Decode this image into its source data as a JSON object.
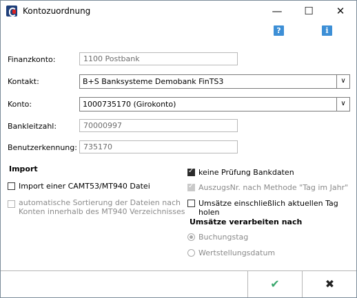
{
  "window": {
    "title": "Kontozuordnung"
  },
  "titlebar_controls": {
    "minimize": "—",
    "maximize": "☐",
    "close": "✕"
  },
  "help": {
    "question": "?",
    "info": "i"
  },
  "fields": {
    "finanzkonto": {
      "label": "Finanzkonto:",
      "value": "1100 Postbank"
    },
    "kontakt": {
      "label": "Kontakt:",
      "value": "B+S Banksysteme Demobank FinTS3"
    },
    "konto": {
      "label": "Konto:",
      "value": "1000735170 (Girokonto)"
    },
    "bankleitzahl": {
      "label": "Bankleitzahl:",
      "value": "70000997"
    },
    "benutzerkennung": {
      "label": "Benutzerkennung:",
      "value": "735170"
    }
  },
  "import": {
    "heading": "Import",
    "camt_label": "Import einer CAMT53/MT940 Datei",
    "sort_label_1": "automatische Sortierung der Dateien nach",
    "sort_label_2": "Konten innerhalb des MT940 Verzeichnisses"
  },
  "options": {
    "keine_pruefung": "keine Prüfung Bankdaten",
    "auszugsnr": "AuszugsNr. nach Methode \"Tag im Jahr\"",
    "umsaetze_aktuell": "Umsätze einschließlich aktuellen Tag holen"
  },
  "umsaetze": {
    "heading": "Umsätze verarbeiten nach",
    "buchungstag": "Buchungstag",
    "wertstellungsdatum": "Wertstellungsdatum"
  },
  "footer": {
    "ok": "✔",
    "cancel": "✖"
  },
  "colors": {
    "ok": "#3aa76d",
    "cancel": "#222222",
    "help": "#3d8fd6"
  }
}
